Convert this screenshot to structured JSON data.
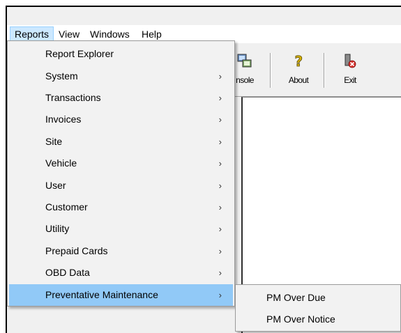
{
  "menubar": {
    "items": [
      {
        "label": "Reports"
      },
      {
        "label": "View"
      },
      {
        "label": "Windows"
      },
      {
        "label": "Help"
      }
    ]
  },
  "toolbar": {
    "console_label": "nsole",
    "about_label": "About",
    "exit_label": "Exit"
  },
  "reports_menu": {
    "items": [
      {
        "label": "Report Explorer",
        "has_submenu": false
      },
      {
        "label": "System",
        "has_submenu": true
      },
      {
        "label": "Transactions",
        "has_submenu": true
      },
      {
        "label": "Invoices",
        "has_submenu": true
      },
      {
        "label": "Site",
        "has_submenu": true
      },
      {
        "label": "Vehicle",
        "has_submenu": true
      },
      {
        "label": "User",
        "has_submenu": true
      },
      {
        "label": "Customer",
        "has_submenu": true
      },
      {
        "label": "Utility",
        "has_submenu": true
      },
      {
        "label": "Prepaid Cards",
        "has_submenu": true
      },
      {
        "label": "OBD Data",
        "has_submenu": true
      },
      {
        "label": "Preventative Maintenance",
        "has_submenu": true,
        "highlighted": true
      }
    ],
    "arrow_glyph": "›"
  },
  "pm_submenu": {
    "items": [
      {
        "label": "PM Over Due"
      },
      {
        "label": "PM Over Notice"
      }
    ]
  },
  "colors": {
    "menu_highlight": "#91c9f7",
    "menubar_active": "#cce8ff",
    "menu_background": "#f2f2f2"
  }
}
